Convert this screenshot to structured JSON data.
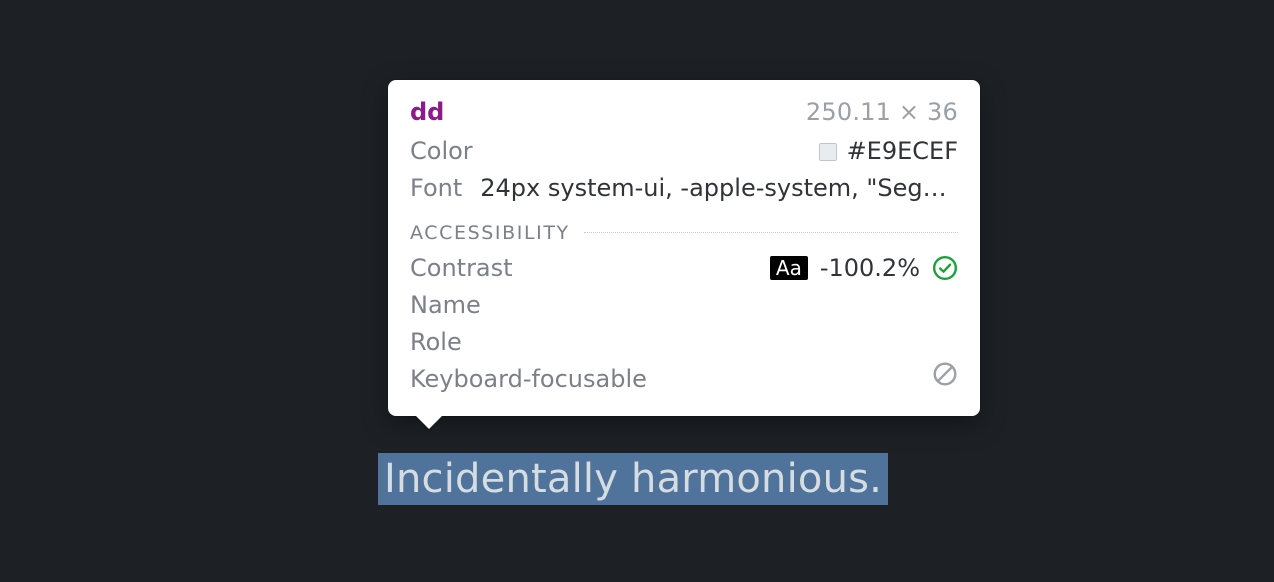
{
  "highlight_text": "Incidentally harmonious.",
  "tooltip": {
    "element_tag": "dd",
    "dimensions": "250.11 × 36",
    "style": {
      "color_label": "Color",
      "color_value": "#E9ECEF",
      "font_label": "Font",
      "font_value": "24px system-ui, -apple-system, \"Segoe…"
    },
    "accessibility": {
      "section_title": "ACCESSIBILITY",
      "contrast_label": "Contrast",
      "contrast_badge": "Aa",
      "contrast_value": "-100.2%",
      "name_label": "Name",
      "role_label": "Role",
      "kbd_label": "Keyboard-focusable"
    }
  }
}
